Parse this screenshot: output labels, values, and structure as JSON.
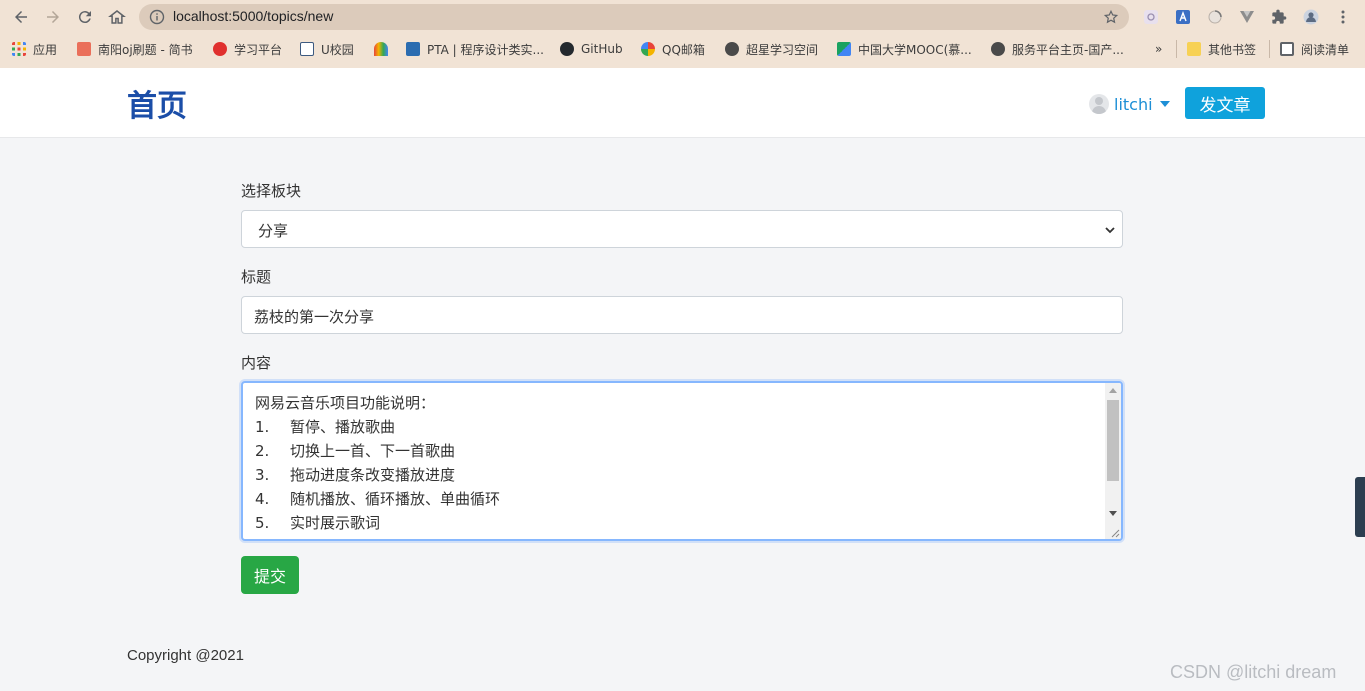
{
  "browser": {
    "url": "localhost:5000/topics/new",
    "bookmarks": [
      {
        "label": "应用",
        "color": "#e8453c"
      },
      {
        "label": "南阳oj刷题 - 简书",
        "color": "#ea6f5a"
      },
      {
        "label": "学习平台",
        "color": "#e0302e"
      },
      {
        "label": "U校园",
        "color": "#3d5a80"
      },
      {
        "label": "",
        "color": "#f4b400"
      },
      {
        "label": "PTA | 程序设计类实...",
        "color": "#2b6cb0"
      },
      {
        "label": "GitHub",
        "color": "#24292e"
      },
      {
        "label": "QQ邮箱",
        "color": "#f5a623"
      },
      {
        "label": "超星学习空间",
        "color": "#4a4a4a"
      },
      {
        "label": "中国大学MOOC(慕...",
        "color": "#1aa260"
      },
      {
        "label": "服务平台主页-国产...",
        "color": "#4a4a4a"
      },
      {
        "label": "其他书签",
        "color": "#f7d154"
      },
      {
        "label": "阅读清单",
        "color": "#5f6368"
      }
    ],
    "more_bookmarks": "»"
  },
  "navbar": {
    "brand": "首页",
    "username": "litchi",
    "post_button": "发文章"
  },
  "form": {
    "board_label": "选择板块",
    "board_value": "分享",
    "title_label": "标题",
    "title_value": "荔枝的第一次分享",
    "content_label": "内容",
    "content_heading": "网易云音乐项目功能说明：",
    "content_lines": [
      {
        "num": "1.",
        "text": "暂停、播放歌曲"
      },
      {
        "num": "2.",
        "text": "切换上一首、下一首歌曲"
      },
      {
        "num": "3.",
        "text": "拖动进度条改变播放进度"
      },
      {
        "num": "4.",
        "text": "随机播放、循环播放、单曲循环"
      },
      {
        "num": "5.",
        "text": "实时展示歌词"
      }
    ],
    "submit_label": "提交"
  },
  "footer": {
    "copyright": "Copyright @2021"
  },
  "watermark": "CSDN @litchi dream",
  "colors": {
    "brand": "#1b4ea8",
    "link": "#1d8fd6",
    "post_button": "#0fa2dc",
    "submit_button": "#28a745",
    "chrome": "#f1e3d5"
  }
}
